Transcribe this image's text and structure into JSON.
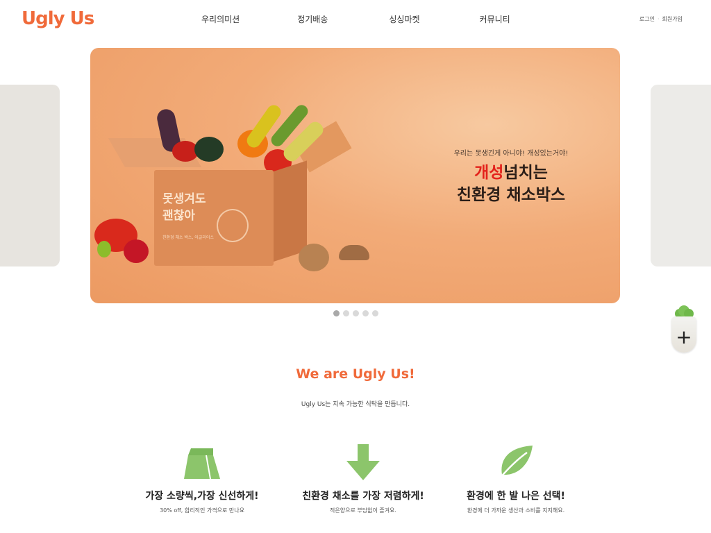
{
  "header": {
    "logo": "Ugly Us",
    "nav": [
      "우리의미션",
      "정기배송",
      "싱싱마켓",
      "커뮤니티"
    ],
    "login": "로그인",
    "signup": "회원가입"
  },
  "hero": {
    "subtitle": "우리는 못생긴게 아니야! 개성있는거야!",
    "title_highlight": "개성",
    "title_rest": "넘치는",
    "title_line2": "친환경 채소박스",
    "box_text_line1": "못생겨도",
    "box_text_line2": "괜찮아",
    "box_small_text": "친환경 채소 박스, 어글리어스"
  },
  "slider": {
    "dots": 5,
    "active_dot": 0
  },
  "floating_button": {
    "icon": "plus-icon"
  },
  "about": {
    "title": "We are Ugly Us!",
    "subtitle": "Ugly Us는 지속 가능한 식탁을 만듭니다."
  },
  "features": [
    {
      "icon": "bag-icon",
      "title": "가장 소량씩,가장 신선하게!",
      "desc": "30% off, 합리적인 가격으로 만나요"
    },
    {
      "icon": "arrow-down-icon",
      "title": "친환경 채소를 가장 저렴하게!",
      "desc": "적은양으로 부담없이 즐겨요."
    },
    {
      "icon": "leaf-icon",
      "title": "환경에 한 발 나은 선택!",
      "desc": "환경에 더 가까운 생산과 소비를 지지해요."
    }
  ],
  "colors": {
    "brand": "#f06a3a",
    "icon_green": "#8cc56b",
    "hero_bg": "#f2ab78",
    "highlight_red": "#e3221b"
  }
}
